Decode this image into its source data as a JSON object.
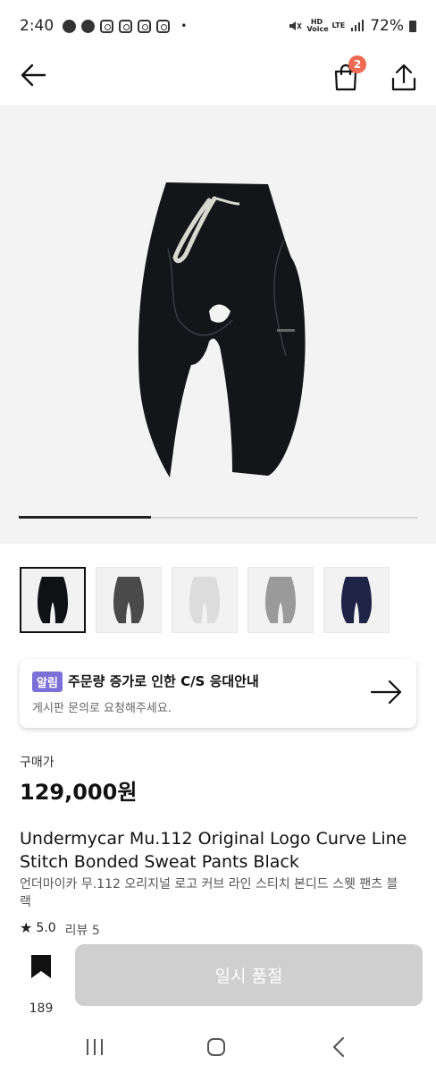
{
  "status_bar": {
    "time": "2:40",
    "notification_icons": [
      "kakaotalk-icon",
      "chat-icon",
      "instagram-icon",
      "instagram-icon",
      "instagram-icon",
      "instagram-icon"
    ],
    "extra_dot": "•",
    "hd_voice": "HD Voice",
    "network": "LTE",
    "battery_percent": "72%"
  },
  "header": {
    "cart_badge_count": "2"
  },
  "gallery": {
    "progress_fraction": 0.33,
    "thumbnails": [
      {
        "color": "#0f1115",
        "selected": true
      },
      {
        "color": "#4a4a4a",
        "selected": false
      },
      {
        "color": "#dcdcdc",
        "selected": false
      },
      {
        "color": "#9a9a9a",
        "selected": false
      },
      {
        "color": "#1f2447",
        "selected": false
      }
    ]
  },
  "notice": {
    "badge": "알림",
    "title": "주문량 증가로 인한 C/S 응대안내",
    "subtitle": "게시판 문의로 요청해주세요."
  },
  "price": {
    "label": "구매가",
    "value": "129,000원"
  },
  "product": {
    "title": "Undermycar Mu.112 Original Logo Curve Line Stitch Bonded Sweat Pants Black",
    "subtitle": "언더마이카 무.112 오리지널 로고 커브 라인 스티치 본디드 스웻 팬츠 블랙",
    "rating": "5.0",
    "review_label": "리뷰 5"
  },
  "actions": {
    "bookmark_count": "189",
    "soldout_label": "일시 품절"
  },
  "colors": {
    "badge_orange": "#ee6a52",
    "notice_purple": "#7b6fd8",
    "soldout_gray": "#cfcfcf"
  }
}
